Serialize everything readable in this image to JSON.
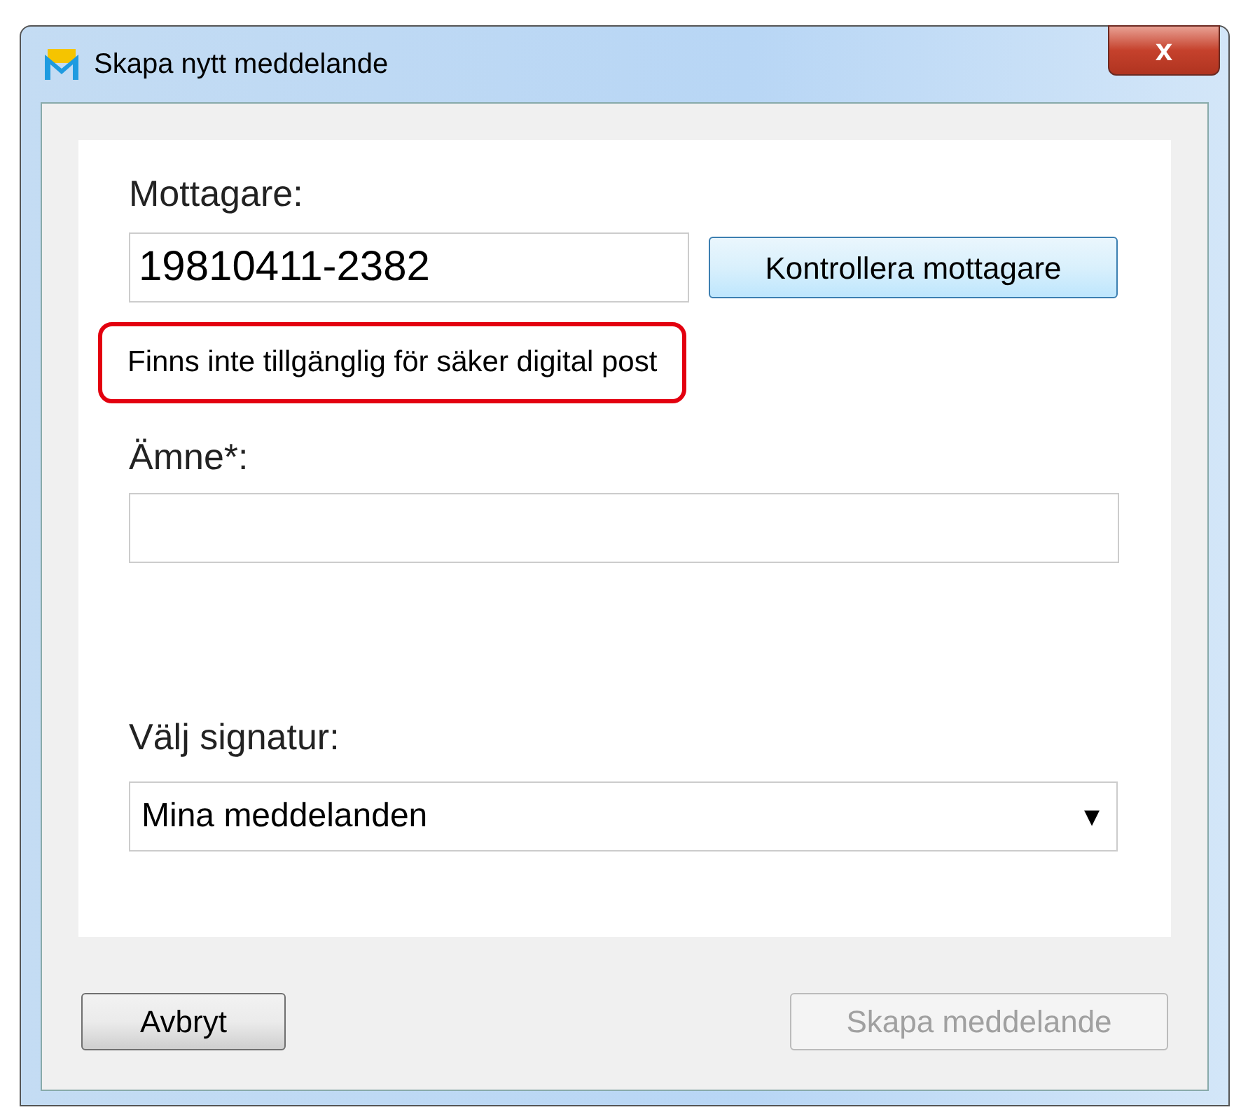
{
  "window": {
    "title": "Skapa nytt meddelande",
    "close_label": "x"
  },
  "recipient": {
    "label": "Mottagare:",
    "value": "19810411-2382",
    "check_button": "Kontrollera mottagare"
  },
  "status_message": {
    "text": "Finns inte tillgänglig för säker digital post",
    "highlighted": true
  },
  "subject": {
    "label": "Ämne*:"
  },
  "signature": {
    "label": "Välj signatur:",
    "value": "Mina meddelanden",
    "arrow": "▾"
  },
  "buttons": [
    {
      "label": "Avbryt",
      "disabled": false
    },
    {
      "label": "Skapa meddelande",
      "disabled": true
    }
  ]
}
